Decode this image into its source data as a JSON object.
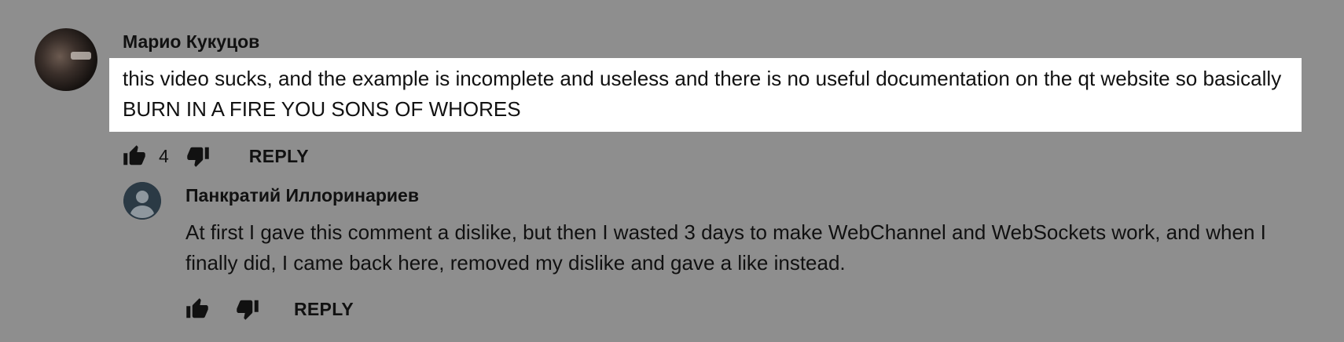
{
  "comments": [
    {
      "author": "Марио Кукуцов",
      "text": "this video sucks, and the example is incomplete and useless and there is no useful documentation on the qt website so basically BURN IN A FIRE YOU SONS OF WHORES",
      "likes": "4",
      "reply_label": "REPLY",
      "avatar_icon": "user-photo-avatar"
    }
  ],
  "replies": [
    {
      "author": "Панкратий Иллоринариев",
      "text": "At first I gave this comment a dislike, but then I wasted 3 days to make WebChannel and WebSockets work, and when I finally did, I came back here, removed my dislike and gave a like instead.",
      "likes": "",
      "reply_label": "REPLY",
      "avatar_icon": "default-user-avatar"
    }
  ],
  "colors": {
    "background": "#8e8e8e",
    "highlight": "#ffffff",
    "text": "#111111",
    "default_avatar": "#2b3a45"
  },
  "icons": [
    "thumbs-up-icon",
    "thumbs-down-icon"
  ]
}
